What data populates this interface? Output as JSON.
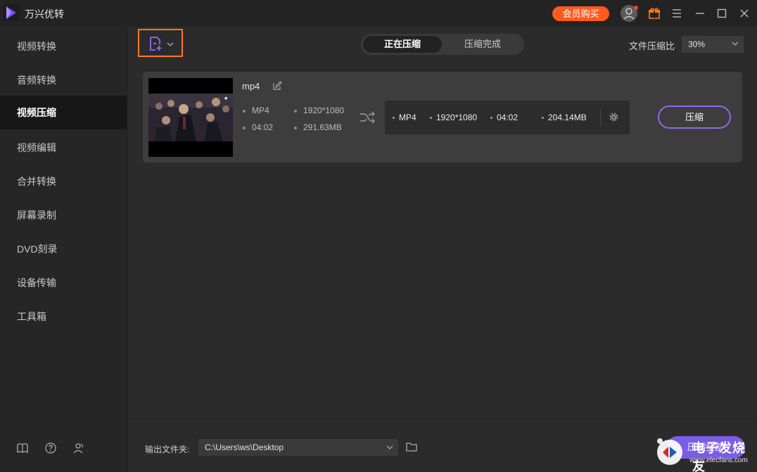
{
  "app": {
    "title": "万兴优转",
    "vip_label": "会员购买"
  },
  "sidebar": {
    "items": [
      {
        "label": "视频转换"
      },
      {
        "label": "音频转换"
      },
      {
        "label": "视频压缩"
      },
      {
        "label": "视频编辑"
      },
      {
        "label": "合并转换"
      },
      {
        "label": "屏幕录制"
      },
      {
        "label": "DVD刻录"
      },
      {
        "label": "设备传输"
      },
      {
        "label": "工具箱"
      }
    ],
    "active": "视频压缩",
    "bottom_icons": [
      "book-icon",
      "help-icon",
      "users-icon"
    ]
  },
  "toolbar": {
    "tabs": [
      {
        "label": "正在压缩"
      },
      {
        "label": "压缩完成"
      }
    ],
    "ratio_label": "文件压缩比",
    "ratio_value": "30%"
  },
  "file": {
    "name": "mp4",
    "source": {
      "format": "MP4",
      "resolution": "1920*1080",
      "duration": "04:02",
      "size": "291.63MB"
    },
    "output": {
      "format": "MP4",
      "resolution": "1920*1080",
      "duration": "04:02",
      "size": "204.14MB"
    },
    "compress_label": "压缩"
  },
  "bottom": {
    "output_label": "输出文件夹:",
    "output_path": "C:\\Users\\ws\\Desktop",
    "start_all_label": "压缩全部"
  },
  "watermark": {
    "line1": "电子发烧友",
    "line2": "www.elecfans.com"
  },
  "colors": {
    "accent": "#7b5ce6",
    "vip": "#ff5a1e",
    "highlight": "#ff7a1a"
  }
}
